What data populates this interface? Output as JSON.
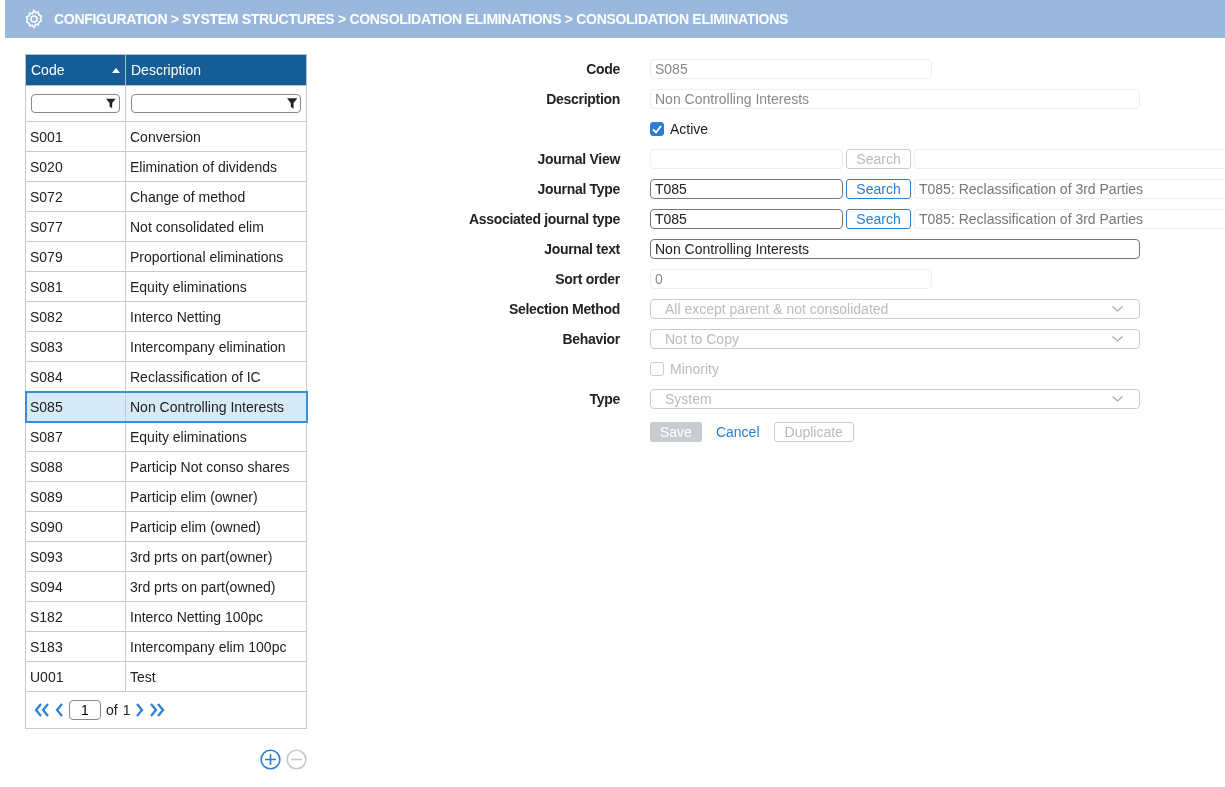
{
  "header": {
    "breadcrumb": "CONFIGURATION > SYSTEM STRUCTURES > CONSOLIDATION ELIMINATIONS > CONSOLIDATION ELIMINATIONS"
  },
  "table": {
    "columns": [
      {
        "label": "Code",
        "sorted": true
      },
      {
        "label": "Description",
        "sorted": false
      }
    ],
    "rows": [
      {
        "code": "S001",
        "description": "Conversion",
        "selected": false
      },
      {
        "code": "S020",
        "description": "Elimination of dividends",
        "selected": false
      },
      {
        "code": "S072",
        "description": "Change of method",
        "selected": false
      },
      {
        "code": "S077",
        "description": "Not consolidated elim",
        "selected": false
      },
      {
        "code": "S079",
        "description": "Proportional eliminations",
        "selected": false
      },
      {
        "code": "S081",
        "description": "Equity eliminations",
        "selected": false
      },
      {
        "code": "S082",
        "description": "Interco Netting",
        "selected": false
      },
      {
        "code": "S083",
        "description": "Intercompany elimination",
        "selected": false
      },
      {
        "code": "S084",
        "description": "Reclassification of IC",
        "selected": false
      },
      {
        "code": "S085",
        "description": "Non Controlling Interests",
        "selected": true
      },
      {
        "code": "S087",
        "description": "Equity eliminations",
        "selected": false
      },
      {
        "code": "S088",
        "description": "Particip Not conso shares",
        "selected": false
      },
      {
        "code": "S089",
        "description": "Particip elim (owner)",
        "selected": false
      },
      {
        "code": "S090",
        "description": "Particip elim (owned)",
        "selected": false
      },
      {
        "code": "S093",
        "description": "3rd prts on part(owner)",
        "selected": false
      },
      {
        "code": "S094",
        "description": "3rd prts on part(owned)",
        "selected": false
      },
      {
        "code": "S182",
        "description": "Interco Netting 100pc",
        "selected": false
      },
      {
        "code": "S183",
        "description": "Intercompany elim 100pc",
        "selected": false
      },
      {
        "code": "U001",
        "description": "Test",
        "selected": false
      }
    ],
    "pager": {
      "page": "1",
      "of": "of",
      "total": "1"
    },
    "remove_disabled": true
  },
  "form": {
    "fields": [
      {
        "kind": "short",
        "label": "Code",
        "value": "S085",
        "disabled": true
      },
      {
        "kind": "long",
        "label": "Description",
        "value": "Non Controlling Interests",
        "disabled": true
      },
      {
        "kind": "checkbox",
        "label": "Active",
        "checked": true,
        "disabled": false
      },
      {
        "kind": "lookup",
        "label": "Journal View",
        "button": "Search",
        "disabled": true
      },
      {
        "kind": "lookup",
        "label": "Journal Type",
        "value": "T085",
        "button": "Search",
        "description": "T085: Reclassification of 3rd Parties",
        "disabled": false
      },
      {
        "kind": "lookup",
        "label": "Associated journal type",
        "value": "T085",
        "button": "Search",
        "description": "T085: Reclassification of 3rd Parties",
        "disabled": false
      },
      {
        "kind": "long",
        "label": "Journal text",
        "value": "Non Controlling Interests",
        "disabled": false
      },
      {
        "kind": "short",
        "label": "Sort order",
        "value": "0",
        "disabled": true
      },
      {
        "kind": "select",
        "label": "Selection Method",
        "value": "All except parent & not consolidated",
        "disabled": true
      },
      {
        "kind": "select",
        "label": "Behavior",
        "value": "Not to Copy",
        "disabled": true
      },
      {
        "kind": "checkbox",
        "label": "Minority",
        "checked": false,
        "disabled": true
      },
      {
        "kind": "select",
        "label": "Type",
        "value": "System",
        "disabled": true
      }
    ],
    "buttons": [
      {
        "kind": "primary",
        "label": "Save",
        "disabled": true
      },
      {
        "kind": "link",
        "label": "Cancel",
        "disabled": false
      },
      {
        "kind": "outline",
        "label": "Duplicate",
        "disabled": true
      }
    ]
  }
}
